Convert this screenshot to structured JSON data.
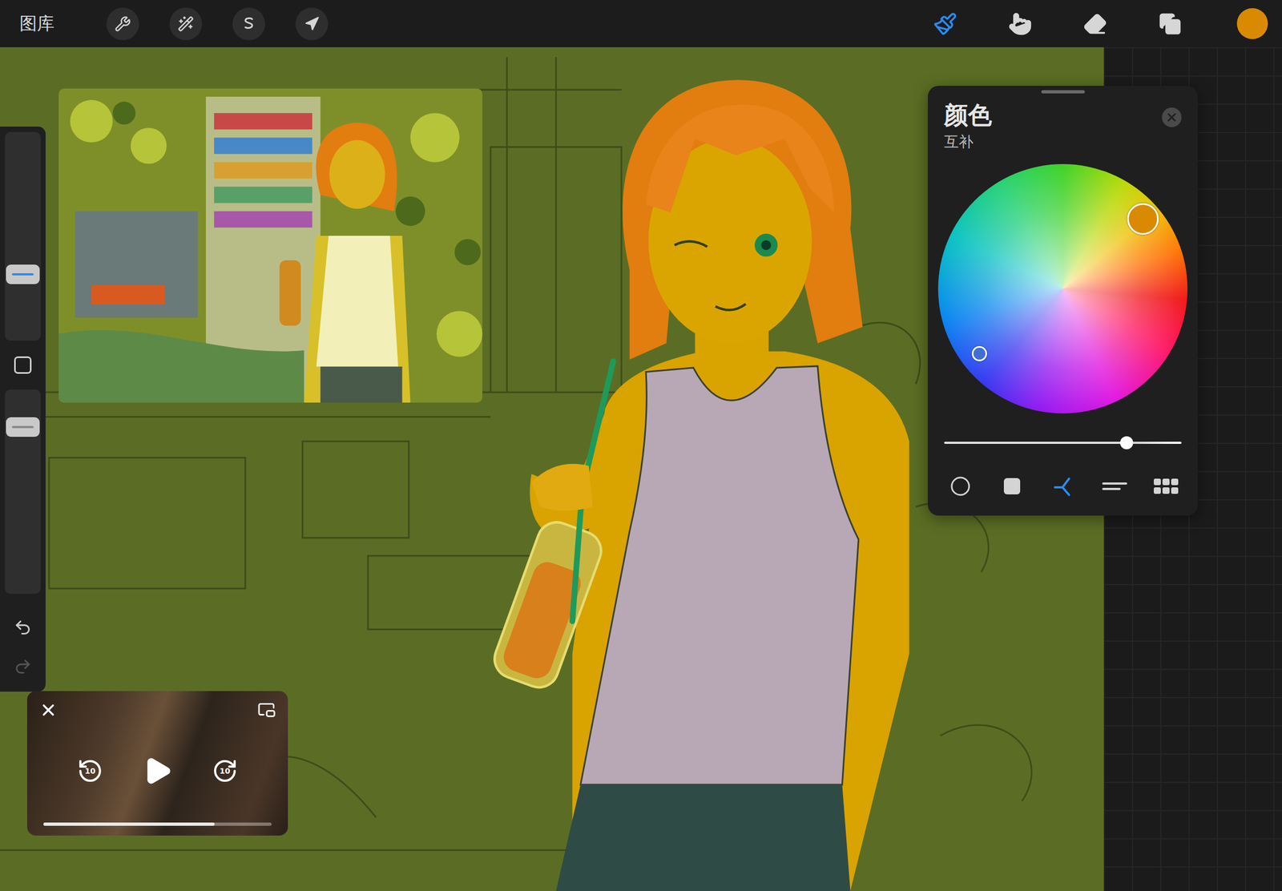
{
  "top_bar": {
    "gallery": "图库",
    "left_tools": [
      {
        "kind": "actions",
        "selected": false
      },
      {
        "kind": "adjustments",
        "selected": false
      },
      {
        "kind": "selection",
        "selected": false
      },
      {
        "kind": "transform",
        "selected": false
      }
    ],
    "right_tools": [
      {
        "kind": "brush",
        "selected": true
      },
      {
        "kind": "smudge",
        "selected": false
      },
      {
        "kind": "eraser",
        "selected": false
      },
      {
        "kind": "layers",
        "selected": false
      }
    ],
    "current_color": "#d98a00"
  },
  "sidebar": {
    "size": {
      "level": 0.3,
      "active": true
    },
    "opacity": {
      "level": 0.85,
      "active": false
    },
    "undo": {
      "disabled": false
    },
    "redo": {
      "disabled": true
    }
  },
  "color_panel": {
    "title": "颜色",
    "mode": "互补",
    "primary": {
      "color": "#d98a00",
      "angle": 49,
      "distance": 0.85
    },
    "complement": {
      "color": "#3f6fd0",
      "angle": 232,
      "distance": 0.85
    },
    "brightness": {
      "level": 0.77
    },
    "tabs": [
      {
        "kind": "disc",
        "selected": false
      },
      {
        "kind": "classic",
        "selected": false
      },
      {
        "kind": "harmony",
        "selected": true
      },
      {
        "kind": "value",
        "selected": false
      },
      {
        "kind": "palettes",
        "selected": false
      }
    ]
  },
  "video": {
    "rewind": "10",
    "forward": "10",
    "playing": false,
    "progress": 0.75
  }
}
